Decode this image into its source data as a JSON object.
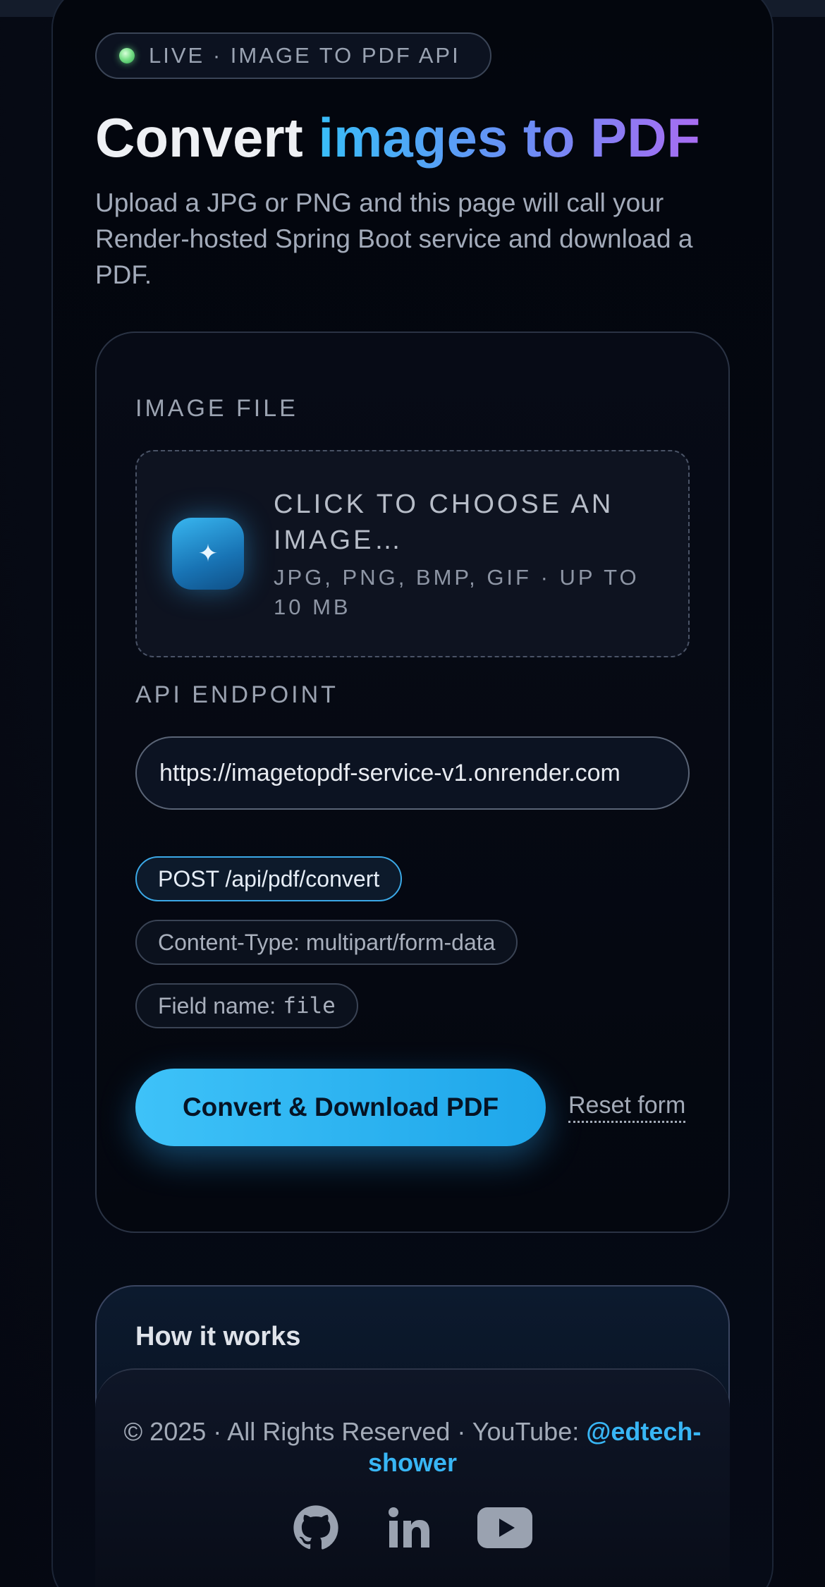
{
  "badge": {
    "text": "LIVE · IMAGE TO PDF API"
  },
  "hero": {
    "title_plain": "Convert ",
    "title_highlight": "images to PDF",
    "subtitle": "Upload a JPG or PNG and this page will call your Render-hosted Spring Boot service and download a PDF."
  },
  "form": {
    "image_label": "IMAGE FILE",
    "dropzone_title": "CLICK TO CHOOSE AN IMAGE…",
    "dropzone_hint": "JPG, PNG, BMP, GIF · UP TO 10 MB",
    "dropzone_icon": "sparkle-icon",
    "endpoint_label": "API ENDPOINT",
    "endpoint_value": "https://imagetopdf-service-v1.onrender.com",
    "chips": {
      "method": "POST /api/pdf/convert",
      "content_type": "Content-Type: multipart/form-data",
      "field_prefix": "Field name:",
      "field_value": "file"
    },
    "convert_label": "Convert & Download PDF",
    "reset_label": "Reset form"
  },
  "how": {
    "title": "How it works"
  },
  "footer": {
    "copyright": "© 2025 · All Rights Reserved · YouTube: ",
    "handle": "@edtech-shower",
    "icons": [
      "github-icon",
      "linkedin-icon",
      "youtube-icon"
    ]
  },
  "colors": {
    "accent": "#38bdf8",
    "accent_purple": "#a86cf2",
    "live_dot": "#7be08a",
    "background": "#04070f"
  }
}
